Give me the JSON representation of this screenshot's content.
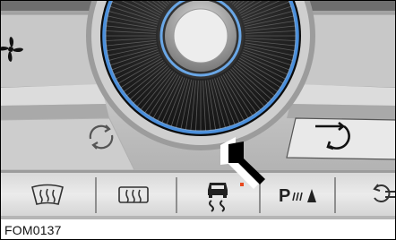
{
  "figure": {
    "label": "FOM0137"
  },
  "controls": {
    "fan_icon": "fan-icon",
    "recirculation_icon": "air-recirculation-icon",
    "outside_air_icon": "outside-air-icon",
    "pointer_icon": "indicator-arrow-icon",
    "buttons": [
      {
        "name": "windscreen-defrost-button",
        "icon": "windscreen-defrost-icon"
      },
      {
        "name": "rear-window-defrost-button",
        "icon": "rear-window-defrost-icon"
      },
      {
        "name": "stability-control-button",
        "icon": "stability-control-off-icon",
        "indicator_color": "#e8491f"
      },
      {
        "name": "parking-aid-button",
        "icon": "parking-aid-icon"
      },
      {
        "name": "lane-keeping-button",
        "icon": "lane-keeping-icon"
      }
    ]
  },
  "colors": {
    "dial_ring": "#4a8fdc",
    "indicator": "#e8491f",
    "bezel": "#bcbcbc"
  }
}
